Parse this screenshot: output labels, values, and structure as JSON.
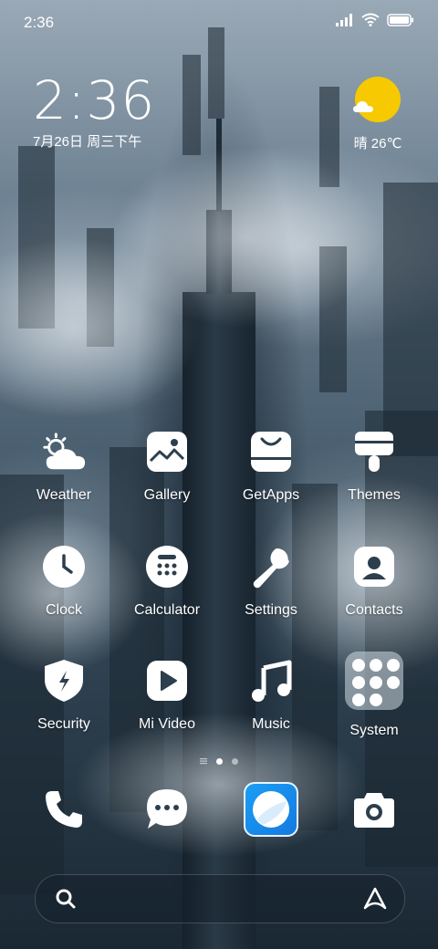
{
  "status_bar": {
    "time": "2:36",
    "icons": [
      "signal-icon",
      "wifi-icon",
      "battery-icon"
    ]
  },
  "clock_widget": {
    "time": "2:36",
    "date": "7月26日 周三下午"
  },
  "weather_widget": {
    "icon": "sun-cloud-icon",
    "text": "晴 26℃"
  },
  "apps": [
    {
      "label": "Weather",
      "icon": "weather-icon"
    },
    {
      "label": "Gallery",
      "icon": "gallery-icon"
    },
    {
      "label": "GetApps",
      "icon": "getapps-icon"
    },
    {
      "label": "Themes",
      "icon": "themes-icon"
    },
    {
      "label": "Clock",
      "icon": "clock-icon"
    },
    {
      "label": "Calculator",
      "icon": "calculator-icon"
    },
    {
      "label": "Settings",
      "icon": "settings-icon"
    },
    {
      "label": "Contacts",
      "icon": "contacts-icon"
    },
    {
      "label": "Security",
      "icon": "security-icon"
    },
    {
      "label": "Mi Video",
      "icon": "mi-video-icon"
    },
    {
      "label": "Music",
      "icon": "music-icon"
    },
    {
      "label": "System",
      "icon": "system-folder-icon"
    }
  ],
  "pager": {
    "pages": 2,
    "active": 0
  },
  "dock": [
    {
      "icon": "phone-icon"
    },
    {
      "icon": "messages-icon"
    },
    {
      "icon": "browser-icon"
    },
    {
      "icon": "camera-icon"
    }
  ],
  "search_bar": {
    "left_icon": "search-icon",
    "right_icon": "assistant-icon"
  },
  "colors": {
    "sun": "#f7c900",
    "browser": "#1a8cf0"
  }
}
